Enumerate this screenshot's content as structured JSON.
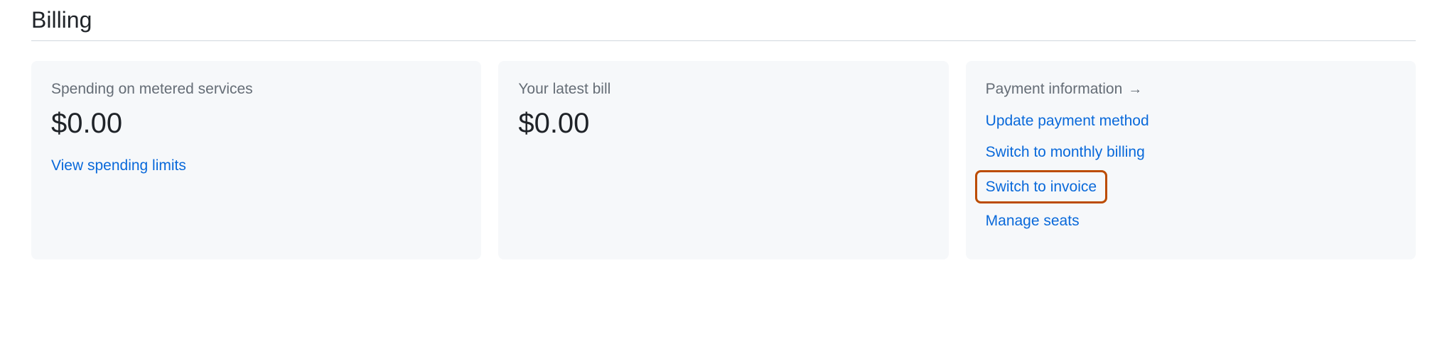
{
  "page": {
    "title": "Billing"
  },
  "cards": {
    "spending": {
      "title": "Spending on metered services",
      "amount": "$0.00",
      "link": "View spending limits"
    },
    "bill": {
      "title": "Your latest bill",
      "amount": "$0.00"
    },
    "payment": {
      "title": "Payment information",
      "links": {
        "update": "Update payment method",
        "monthly": "Switch to monthly billing",
        "invoice": "Switch to invoice",
        "seats": "Manage seats"
      }
    }
  }
}
